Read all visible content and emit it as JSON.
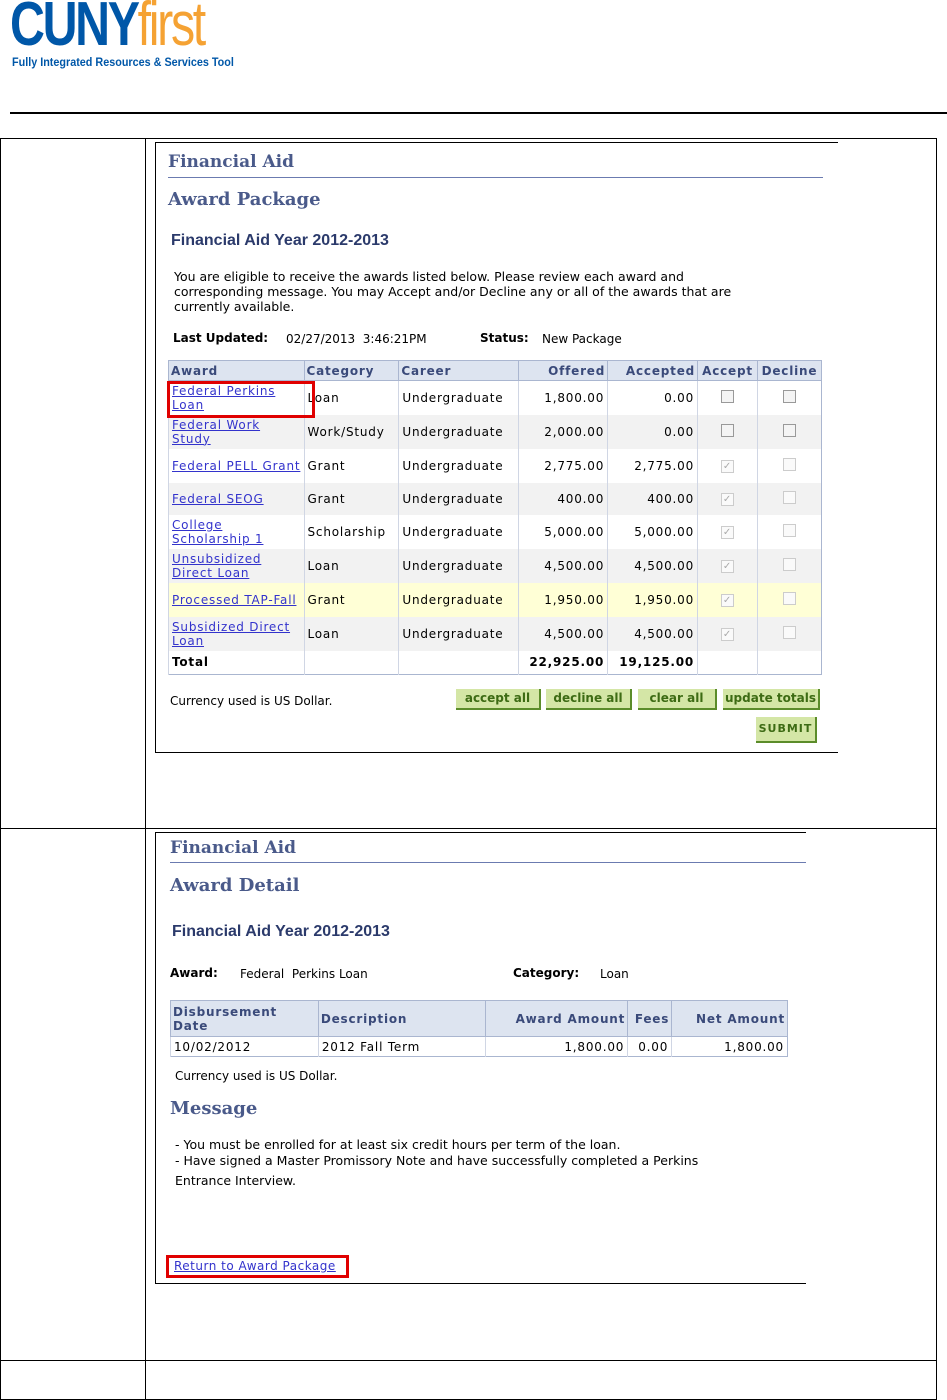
{
  "logo": {
    "main_a": "CUNY",
    "main_b": "first",
    "subtitle": "Fully Integrated Resources & Services Tool"
  },
  "package": {
    "section": "Financial Aid",
    "title": "Award Package",
    "year": "Financial Aid Year 2012-2013",
    "intro": [
      "You are eligible to receive the awards listed below. Please review each award and",
      "corresponding message. You may Accept and/or Decline any or all of the awards that are",
      "currently available."
    ],
    "last_updated_label": "Last Updated:",
    "last_updated": "02/27/2013  3:46:21PM",
    "status_label": "Status:",
    "status": "New Package",
    "columns": [
      "Award",
      "Category",
      "Career",
      "Offered",
      "Accepted",
      "Accept",
      "Decline"
    ],
    "rows": [
      {
        "award": "Federal Perkins Loan",
        "category": "Loan",
        "career": "Undergraduate",
        "offered": "1,800.00",
        "accepted": "0.00",
        "accept": false,
        "enabled": true
      },
      {
        "award": "Federal Work Study",
        "category": "Work/Study",
        "career": "Undergraduate",
        "offered": "2,000.00",
        "accepted": "0.00",
        "accept": false,
        "enabled": true
      },
      {
        "award": "Federal PELL Grant",
        "category": "Grant",
        "career": "Undergraduate",
        "offered": "2,775.00",
        "accepted": "2,775.00",
        "accept": true,
        "enabled": false
      },
      {
        "award": "Federal SEOG",
        "category": "Grant",
        "career": "Undergraduate",
        "offered": "400.00",
        "accepted": "400.00",
        "accept": true,
        "enabled": false
      },
      {
        "award": "College Scholarship 1",
        "category": "Scholarship",
        "career": "Undergraduate",
        "offered": "5,000.00",
        "accepted": "5,000.00",
        "accept": true,
        "enabled": false
      },
      {
        "award": "Unsubsidized Direct Loan",
        "category": "Loan",
        "career": "Undergraduate",
        "offered": "4,500.00",
        "accepted": "4,500.00",
        "accept": true,
        "enabled": false
      },
      {
        "award": "Processed TAP-Fall",
        "category": "Grant",
        "career": "Undergraduate",
        "offered": "1,950.00",
        "accepted": "1,950.00",
        "accept": true,
        "enabled": false
      },
      {
        "award": "Subsidized Direct Loan",
        "category": "Loan",
        "career": "Undergraduate",
        "offered": "4,500.00",
        "accepted": "4,500.00",
        "accept": true,
        "enabled": false
      }
    ],
    "total_label": "Total",
    "total_offered": "22,925.00",
    "total_accepted": "19,125.00",
    "currency": "Currency used is US Dollar.",
    "buttons": {
      "accept_all": "accept all",
      "decline_all": "decline all",
      "clear_all": "clear all",
      "update_totals": "update totals",
      "submit": "SUBMIT"
    }
  },
  "detail": {
    "section": "Financial Aid",
    "title": "Award Detail",
    "year": "Financial Aid Year 2012-2013",
    "award_label": "Award:",
    "award": "Federal  Perkins Loan",
    "category_label": "Category:",
    "category": "Loan",
    "columns": [
      "Disbursement Date",
      "Description",
      "Award Amount",
      "Fees",
      "Net Amount"
    ],
    "row": {
      "date": "10/02/2012",
      "description": "2012 Fall Term",
      "amount": "1,800.00",
      "fees": "0.00",
      "net": "1,800.00"
    },
    "currency": "Currency used is US Dollar.",
    "message_title": "Message",
    "messages": [
      "- You must be enrolled for at least six credit hours per term of the loan.",
      "- Have signed a Master Promissory Note and have successfully completed a Perkins",
      "Entrance Interview."
    ],
    "return_link": "Return to Award Package"
  }
}
